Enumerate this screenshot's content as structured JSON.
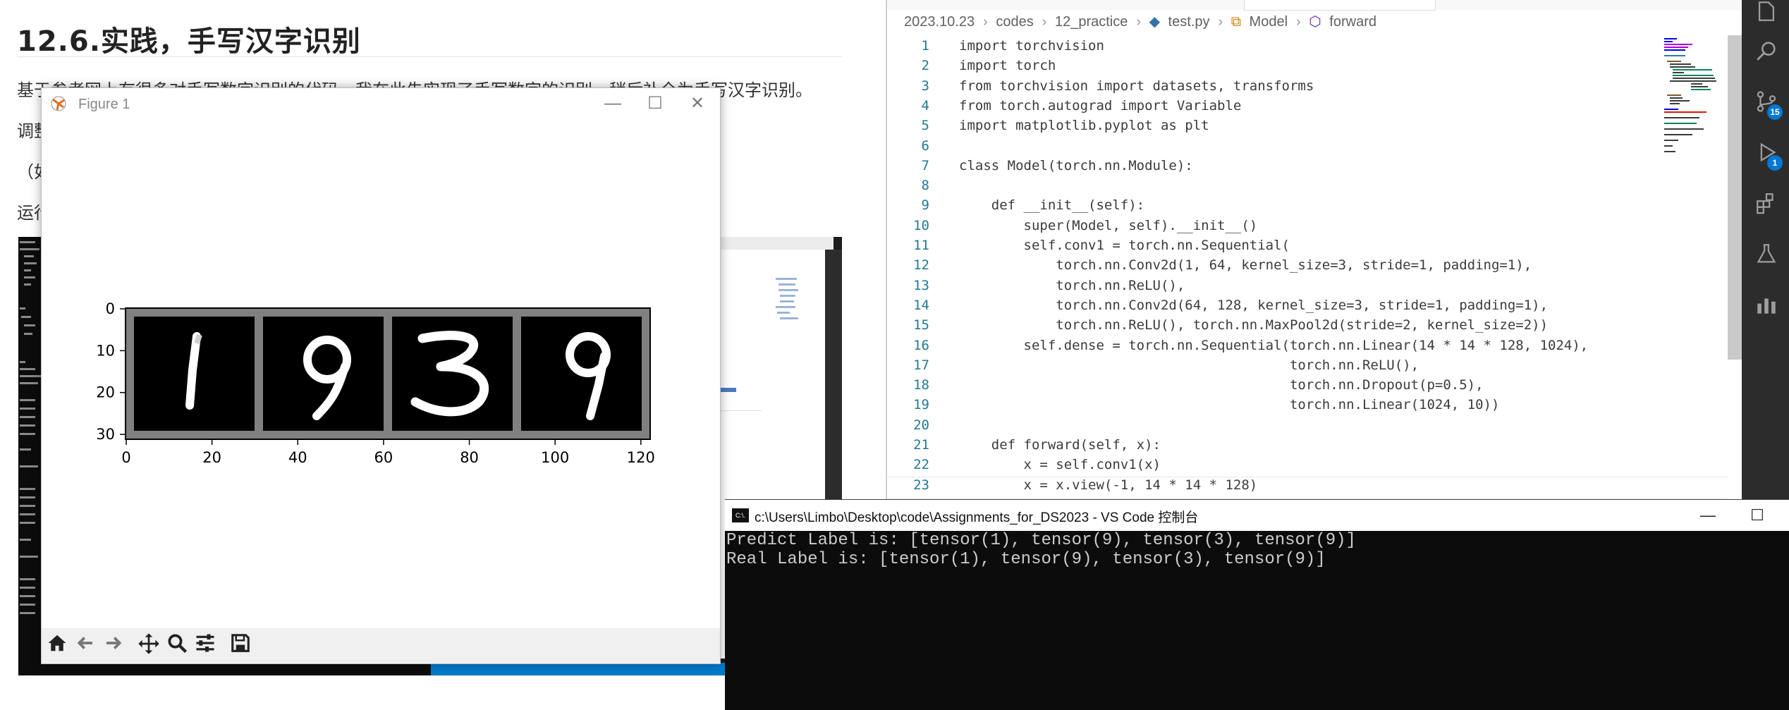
{
  "document": {
    "title": "12.6.实践，手写汉字识别",
    "lines": [
      "基于参考网上有很多对手写数字识别的代码，我在此先实现了手写数字的识别，稍后补全为手写汉字识别。",
      "调整",
      "（如",
      "运行"
    ]
  },
  "vscode": {
    "breadcrumb": [
      "2023.10.23",
      "codes",
      "12_practice",
      "test.py",
      "Model",
      "forward"
    ],
    "code_lines": [
      "import torchvision",
      "import torch",
      "from torchvision import datasets, transforms",
      "from torch.autograd import Variable",
      "import matplotlib.pyplot as plt",
      "",
      "class Model(torch.nn.Module):",
      "",
      "    def __init__(self):",
      "        super(Model, self).__init__()",
      "        self.conv1 = torch.nn.Sequential(",
      "            torch.nn.Conv2d(1, 64, kernel_size=3, stride=1, padding=1),",
      "            torch.nn.ReLU(),",
      "            torch.nn.Conv2d(64, 128, kernel_size=3, stride=1, padding=1),",
      "            torch.nn.ReLU(), torch.nn.MaxPool2d(stride=2, kernel_size=2))",
      "        self.dense = torch.nn.Sequential(torch.nn.Linear(14 * 14 * 128, 1024),",
      "                                         torch.nn.ReLU(),",
      "                                         torch.nn.Dropout(p=0.5),",
      "                                         torch.nn.Linear(1024, 10))",
      "",
      "    def forward(self, x):",
      "        x = self.conv1(x)",
      "        x = x.view(-1, 14 * 14 * 128)"
    ],
    "badges": {
      "source_control": "15",
      "run_debug": "1"
    }
  },
  "figure": {
    "title": "Figure 1",
    "xticks": [
      "0",
      "20",
      "40",
      "60",
      "80",
      "100",
      "120"
    ],
    "yticks": [
      "0",
      "10",
      "20",
      "30"
    ],
    "digits": [
      "1",
      "9",
      "3",
      "9"
    ]
  },
  "console": {
    "title": "c:\\Users\\Limbo\\Desktop\\code\\Assignments_for_DS2023 - VS Code 控制台",
    "icon_text": "C:\\.",
    "lines": [
      "Predict Label is: [tensor(1), tensor(9), tensor(3), tensor(9)]",
      "Real Label is: [tensor(1), tensor(9), tensor(3), tensor(9)]"
    ]
  }
}
